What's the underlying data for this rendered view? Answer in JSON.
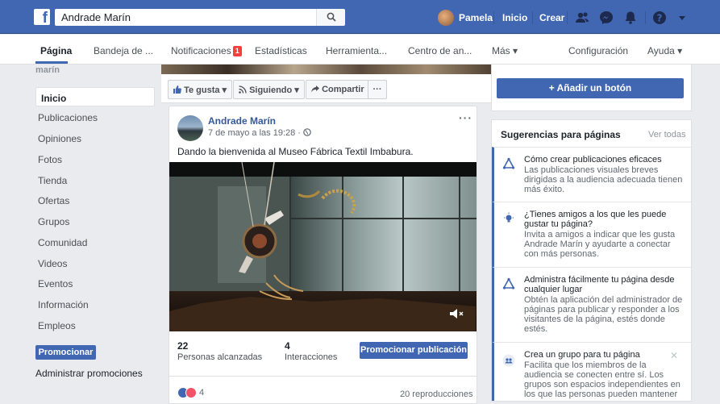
{
  "topbar": {
    "search_value": "Andrade Marín",
    "user_name": "Pamela",
    "home": "Inicio",
    "create": "Crear"
  },
  "pagenav": {
    "items": [
      {
        "label": "Página"
      },
      {
        "label": "Bandeja de ..."
      },
      {
        "label": "Notificaciones",
        "badge": "1"
      },
      {
        "label": "Estadísticas"
      },
      {
        "label": "Herramienta..."
      },
      {
        "label": "Centro de an..."
      },
      {
        "label": "Más ▾"
      },
      {
        "label": "Configuración"
      },
      {
        "label": "Ayuda ▾"
      }
    ]
  },
  "sidebar": {
    "brand": "marín",
    "items": [
      {
        "label": "Inicio"
      },
      {
        "label": "Publicaciones"
      },
      {
        "label": "Opiniones"
      },
      {
        "label": "Fotos"
      },
      {
        "label": "Tienda"
      },
      {
        "label": "Ofertas"
      },
      {
        "label": "Grupos"
      },
      {
        "label": "Comunidad"
      },
      {
        "label": "Videos"
      },
      {
        "label": "Eventos"
      },
      {
        "label": "Información"
      },
      {
        "label": "Empleos"
      }
    ],
    "promote": "Promocionar",
    "manage_promotions": "Administrar promociones"
  },
  "actions": {
    "like": "Te gusta ▾",
    "following": "Siguiendo ▾",
    "share": "Compartir",
    "more": "···",
    "add_button": "+ Añadir un botón"
  },
  "post": {
    "author": "Andrade Marín",
    "time": "7 de mayo a las 19:28 ·",
    "text": "Dando la bienvenida al Museo Fábrica Textil Imbabura.",
    "more": "···",
    "reach_num": "22",
    "reach_label": "Personas alcanzadas",
    "interactions_num": "4",
    "interactions_label": "Interacciones",
    "boost": "Promocionar publicación",
    "reactions_count": "4",
    "views": "20 reproducciones"
  },
  "suggestions": {
    "title": "Sugerencias para páginas",
    "see_all": "Ver todas",
    "items": [
      {
        "title": "Cómo crear publicaciones eficaces",
        "desc": "Las publicaciones visuales breves dirigidas a la audiencia adecuada tienen más éxito."
      },
      {
        "title": "¿Tienes amigos a los que les puede gustar tu página?",
        "desc": "Invita a amigos a indicar que les gusta Andrade Marín y ayudarte a conectar con más personas."
      },
      {
        "title": "Administra fácilmente tu página desde cualquier lugar",
        "desc": "Obtén la aplicación del administrador de páginas para publicar y responder a los visitantes de la página, estés donde estés."
      },
      {
        "title": "Crea un grupo para tu página",
        "desc": "Facilita que los miembros de la audiencia se conecten entre sí. Los grupos son espacios independientes en los que las personas pueden mantener"
      }
    ]
  },
  "colors": {
    "brand": "#4267b2",
    "link": "#365899",
    "badge": "#fa3e3e"
  }
}
